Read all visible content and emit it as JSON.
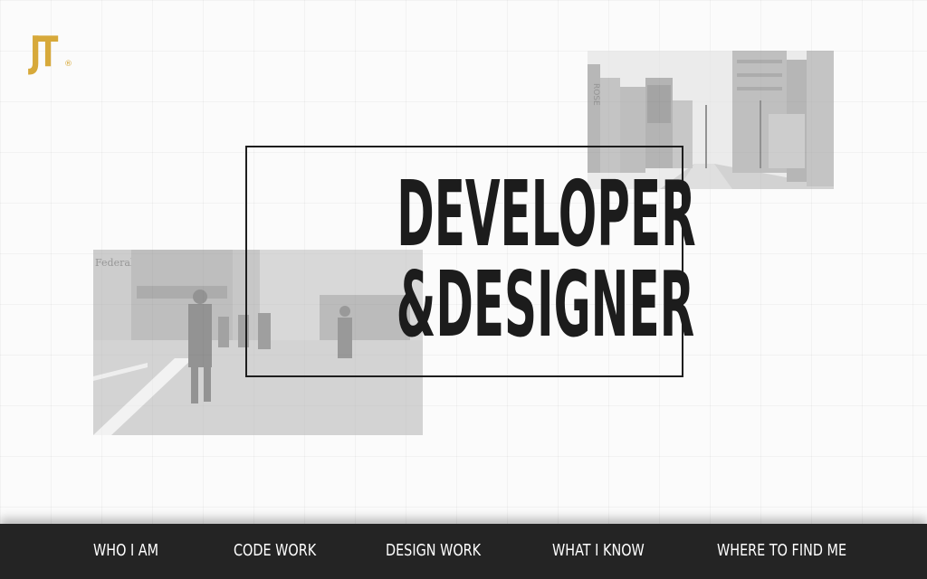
{
  "logo": {
    "text": "JT",
    "registered": "®",
    "color": "#d7a93a"
  },
  "hero": {
    "line1": "DEVELOPER",
    "line2": "&DESIGNER"
  },
  "photos": {
    "street": {
      "sign_text": "ROSE"
    },
    "crowd": {
      "sign_text": "Federal"
    }
  },
  "nav": {
    "items": [
      {
        "label": "WHO I AM"
      },
      {
        "label": "CODE WORK"
      },
      {
        "label": "DESIGN WORK"
      },
      {
        "label": "WHAT I KNOW"
      },
      {
        "label": "WHERE TO FIND ME"
      }
    ],
    "background": "#242424",
    "text_color": "#ffffff"
  }
}
